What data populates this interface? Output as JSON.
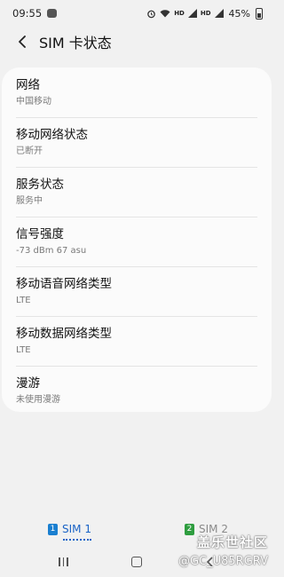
{
  "status_bar": {
    "time": "09:55",
    "hd1": "HD",
    "hd2": "HD",
    "battery_percent": "45%"
  },
  "header": {
    "title": "SIM 卡状态"
  },
  "items": [
    {
      "title": "网络",
      "value": "中国移动"
    },
    {
      "title": "移动网络状态",
      "value": "已断开"
    },
    {
      "title": "服务状态",
      "value": "服务中"
    },
    {
      "title": "信号强度",
      "value": "-73 dBm 67 asu"
    },
    {
      "title": "移动语音网络类型",
      "value": "LTE"
    },
    {
      "title": "移动数据网络类型",
      "value": "LTE"
    },
    {
      "title": "漫游",
      "value": "未使用漫游"
    }
  ],
  "sim_tabs": [
    {
      "num": "1",
      "label": "SIM 1",
      "selected": true,
      "color": "#1a63c6"
    },
    {
      "num": "2",
      "label": "SIM 2",
      "selected": false,
      "color": "#2e9d3f"
    }
  ],
  "watermark": {
    "brand": "盖乐世社区",
    "user": "@GC_U85RGRV"
  },
  "icons": {
    "back": "chevron-left-icon",
    "recents": "recent-apps-icon",
    "home": "home-icon",
    "back_nav": "back-icon"
  }
}
